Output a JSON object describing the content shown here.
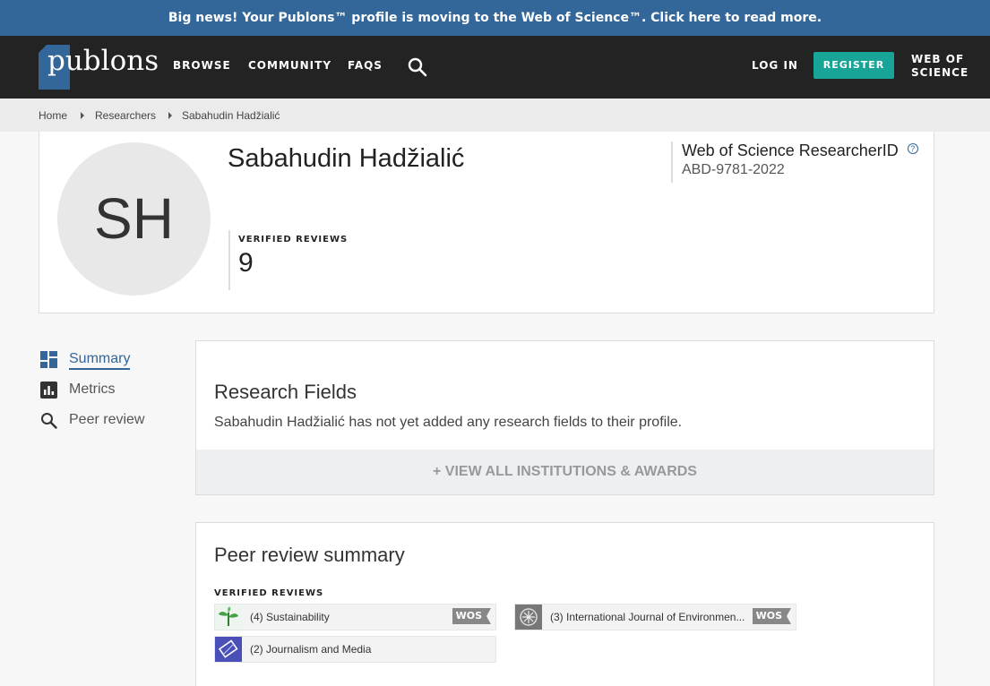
{
  "banner": {
    "text": "Big news! Your Publons™ profile is moving to the Web of Science™. Click here to read more."
  },
  "nav": {
    "logo_text": "publons",
    "browse": "BROWSE",
    "community": "COMMUNITY",
    "faqs": "FAQS",
    "log_in": "LOG IN",
    "register": "REGISTER",
    "web_of_science": "WEB OF SCIENCE"
  },
  "breadcrumb": [
    "Home",
    "Researchers",
    "Sabahudin Hadžialić"
  ],
  "profile": {
    "initials": "SH",
    "name": "Sabahudin Hadžialić",
    "verified_reviews_label": "VERIFIED REVIEWS",
    "verified_reviews_count": "9",
    "researcher_id_label": "Web of Science ResearcherID",
    "researcher_id_help": "?",
    "researcher_id_value": "ABD-9781-2022"
  },
  "sidebar": [
    {
      "label": "Summary",
      "icon": "dashboard-icon",
      "active": true
    },
    {
      "label": "Metrics",
      "icon": "bar-chart-icon",
      "active": false
    },
    {
      "label": "Peer review",
      "icon": "search-icon",
      "active": false
    }
  ],
  "research_fields": {
    "title": "Research Fields",
    "text": "Sabahudin Hadžialić has not yet added any research fields to their profile.",
    "view_all": "+ VIEW ALL INSTITUTIONS & AWARDS"
  },
  "peer_review": {
    "title": "Peer review summary",
    "verified_label": "VERIFIED REVIEWS",
    "journals": [
      {
        "label": "(4) Sustainability",
        "badge": "WOS",
        "icon": "plant-icon"
      },
      {
        "label": "(3) International Journal of Environmen...",
        "badge": "WOS",
        "icon": "journal-cover-icon"
      },
      {
        "label": "(2) Journalism and Media",
        "badge": "",
        "icon": "media-icon"
      }
    ]
  },
  "colors": {
    "banner": "#336699",
    "navbar": "#232323",
    "register": "#18a497",
    "accent": "#336699"
  }
}
